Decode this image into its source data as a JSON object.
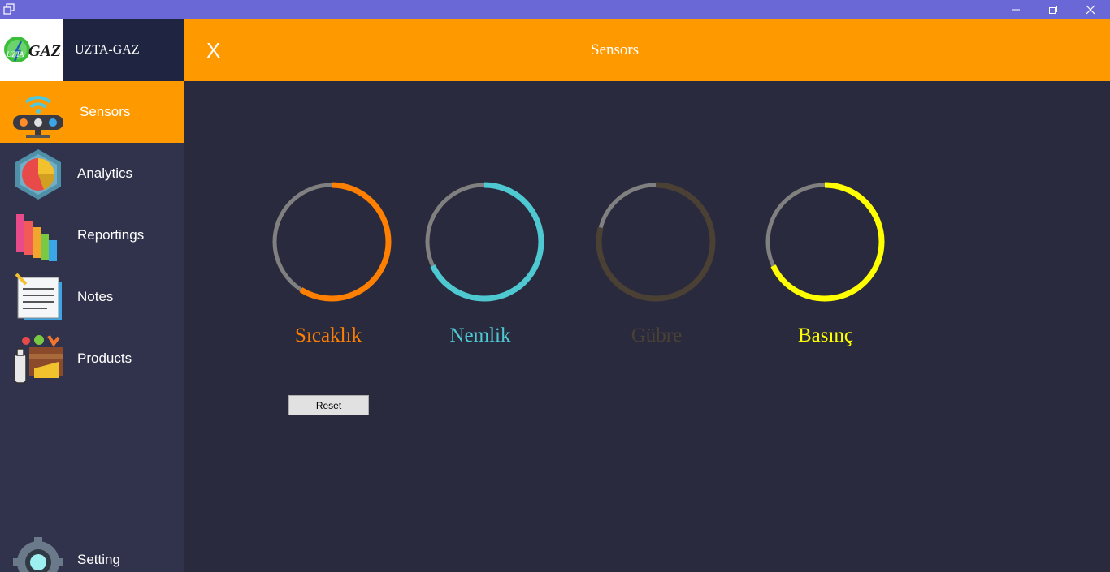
{
  "window": {
    "minimize_icon": "minimize-icon",
    "maximize_icon": "restore-icon",
    "close_icon": "close-icon"
  },
  "brand": {
    "logo_text": "GAZ",
    "logo_small": "UZTA",
    "name": "UZTA-GAZ"
  },
  "header": {
    "close_label": "X",
    "title": "Sensors",
    "color": "#ff9900"
  },
  "sidebar": {
    "items": [
      {
        "label": "Sensors",
        "icon": "sensor-device-icon",
        "active": true
      },
      {
        "label": "Analytics",
        "icon": "pie-chart-icon",
        "active": false
      },
      {
        "label": "Reportings",
        "icon": "bar-chart-icon",
        "active": false
      },
      {
        "label": "Notes",
        "icon": "notepad-icon",
        "active": false
      },
      {
        "label": "Products",
        "icon": "produce-crate-icon",
        "active": false
      },
      {
        "label": "Setting",
        "icon": "gear-icon",
        "active": false
      }
    ]
  },
  "sensors": [
    {
      "name": "Sıcaklık",
      "color": "#ff8000",
      "fill": 0.59
    },
    {
      "name": "Nemlik",
      "color": "#4ec9d2",
      "fill": 0.68
    },
    {
      "name": "Gübre",
      "color": "#4a4034",
      "fill": 0.79
    },
    {
      "name": "Basınç",
      "color": "#ffff00",
      "fill": 0.68
    }
  ],
  "reset_label": "Reset"
}
